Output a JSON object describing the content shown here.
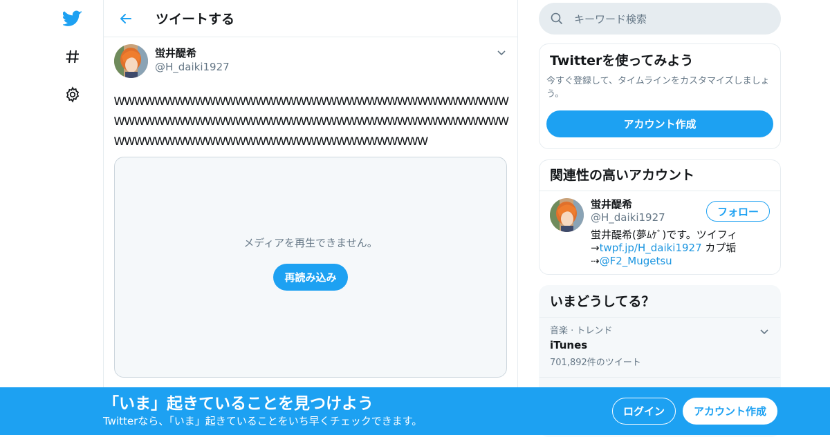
{
  "header": {
    "title": "ツイートする"
  },
  "tweet": {
    "author_name": "蛍井醍希",
    "author_handle": "@H_daiki1927",
    "text": "wwwwwwwwwwwwwwwwwwwwwwwwwwwwwwwwwwwwwwwwwwwwwwwwwwwwwwwwwwwwwwwwwwwwwwwwwwwwwwwwwwwwwwwwwwwwwwwwwwwwwwwwwwwww",
    "media_message": "メディアを再生できません。",
    "reload_label": "再読み込み"
  },
  "search": {
    "placeholder": "キーワード検索"
  },
  "signup_card": {
    "title": "Twitterを使ってみよう",
    "description": "今すぐ登録して、タイムラインをカスタマイズしましょう。",
    "button": "アカウント作成"
  },
  "related": {
    "title": "関連性の高いアカウント",
    "user": {
      "name": "蛍井醍希",
      "handle": "@H_daiki1927",
      "follow_label": "フォロー",
      "bio_prefix": "蛍井醍希(夢ﾑｹﾞ)です。ツイフィ→",
      "bio_link1": "twpf.jp/H_daiki1927",
      "bio_middle": " カプ垢⇢",
      "bio_link2": "@F2_Mugetsu"
    }
  },
  "trends": {
    "title": "いまどうしてる？",
    "items": [
      {
        "meta": "音楽 · トレンド",
        "name": "iTunes",
        "count": "701,892件のツイート"
      }
    ]
  },
  "banner": {
    "title": "「いま」起きていることを見つけよう",
    "subtitle": "Twitterなら、「いま」起きていることをいち早くチェックできます。",
    "login": "ログイン",
    "signup": "アカウント作成"
  },
  "colors": {
    "accent": "#1da1f2",
    "text": "#14171a",
    "muted": "#657786",
    "border": "#e6ecf0"
  },
  "icons": [
    "twitter-bird-icon",
    "hashtag-icon",
    "gear-icon",
    "back-arrow-icon",
    "chevron-down-icon",
    "search-icon"
  ]
}
